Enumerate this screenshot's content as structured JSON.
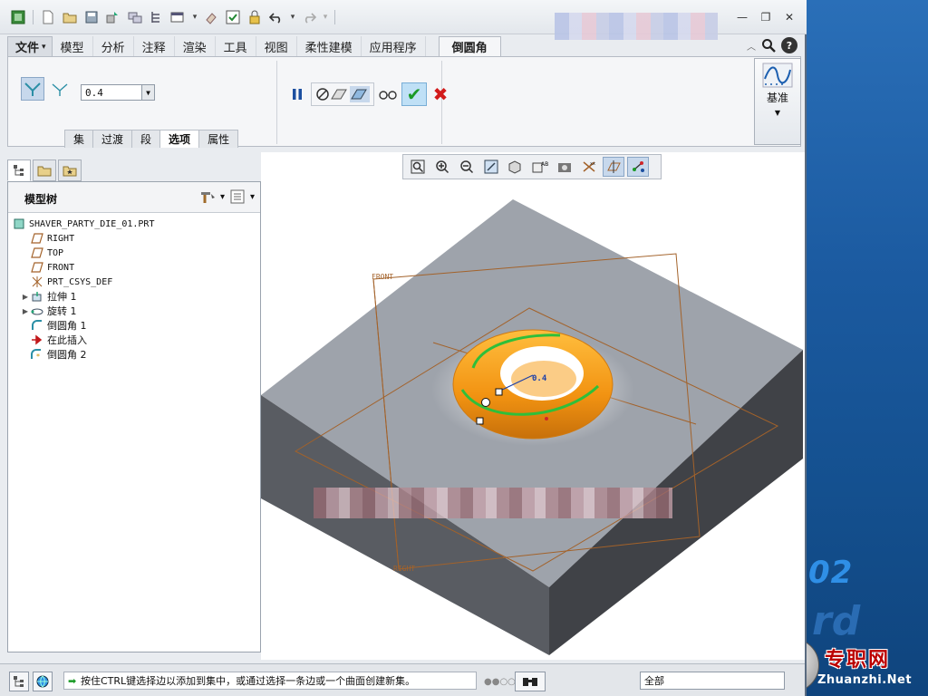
{
  "menu": {
    "file": "文件",
    "items": [
      "模型",
      "分析",
      "注释",
      "渲染",
      "工具",
      "视图",
      "柔性建模",
      "应用程序"
    ],
    "active_tab": "倒圆角"
  },
  "ribbon": {
    "radius_value": "0.4",
    "sub_tabs": [
      "集",
      "过渡",
      "段",
      "选项",
      "属性"
    ],
    "active_sub_tab": "选项",
    "datum_label": "基准"
  },
  "model_tree": {
    "title": "模型树",
    "items": [
      {
        "label": "SHAVER_PARTY_DIE_01.PRT",
        "icon": "part-icon",
        "expand": "",
        "cn": false
      },
      {
        "label": "RIGHT",
        "icon": "datum-plane-icon",
        "expand": "",
        "cn": false
      },
      {
        "label": "TOP",
        "icon": "datum-plane-icon",
        "expand": "",
        "cn": false
      },
      {
        "label": "FRONT",
        "icon": "datum-plane-icon",
        "expand": "",
        "cn": false
      },
      {
        "label": "PRT_CSYS_DEF",
        "icon": "csys-icon",
        "expand": "",
        "cn": false
      },
      {
        "label": "拉伸 1",
        "icon": "extrude-icon",
        "expand": "▶",
        "cn": true
      },
      {
        "label": "旋转 1",
        "icon": "revolve-icon",
        "expand": "▶",
        "cn": true
      },
      {
        "label": "倒圆角 1",
        "icon": "round-icon",
        "expand": "",
        "cn": true
      },
      {
        "label": "在此插入",
        "icon": "insert-here-icon",
        "expand": "",
        "cn": true
      },
      {
        "label": "倒圆角 2",
        "icon": "round-new-icon",
        "expand": "",
        "cn": true
      }
    ]
  },
  "viewport": {
    "labels": {
      "front": "FRONT",
      "right": "RIGHT",
      "dimension": "0.4"
    },
    "colors": {
      "part": "#9fa4ac",
      "side": "#4b4d52",
      "round": "#f3a21b",
      "edge": "#2fbf3a",
      "datum": "#a3622a"
    }
  },
  "status": {
    "message": "按住CTRL键选择边以添加到集中，或通过选择一条边或一个曲面创建新集。",
    "filter": "全部"
  },
  "watermark": {
    "number": "02",
    "letters": "rd",
    "site_cn": "专职网",
    "site_en": "Zhuanzhi.Net"
  }
}
